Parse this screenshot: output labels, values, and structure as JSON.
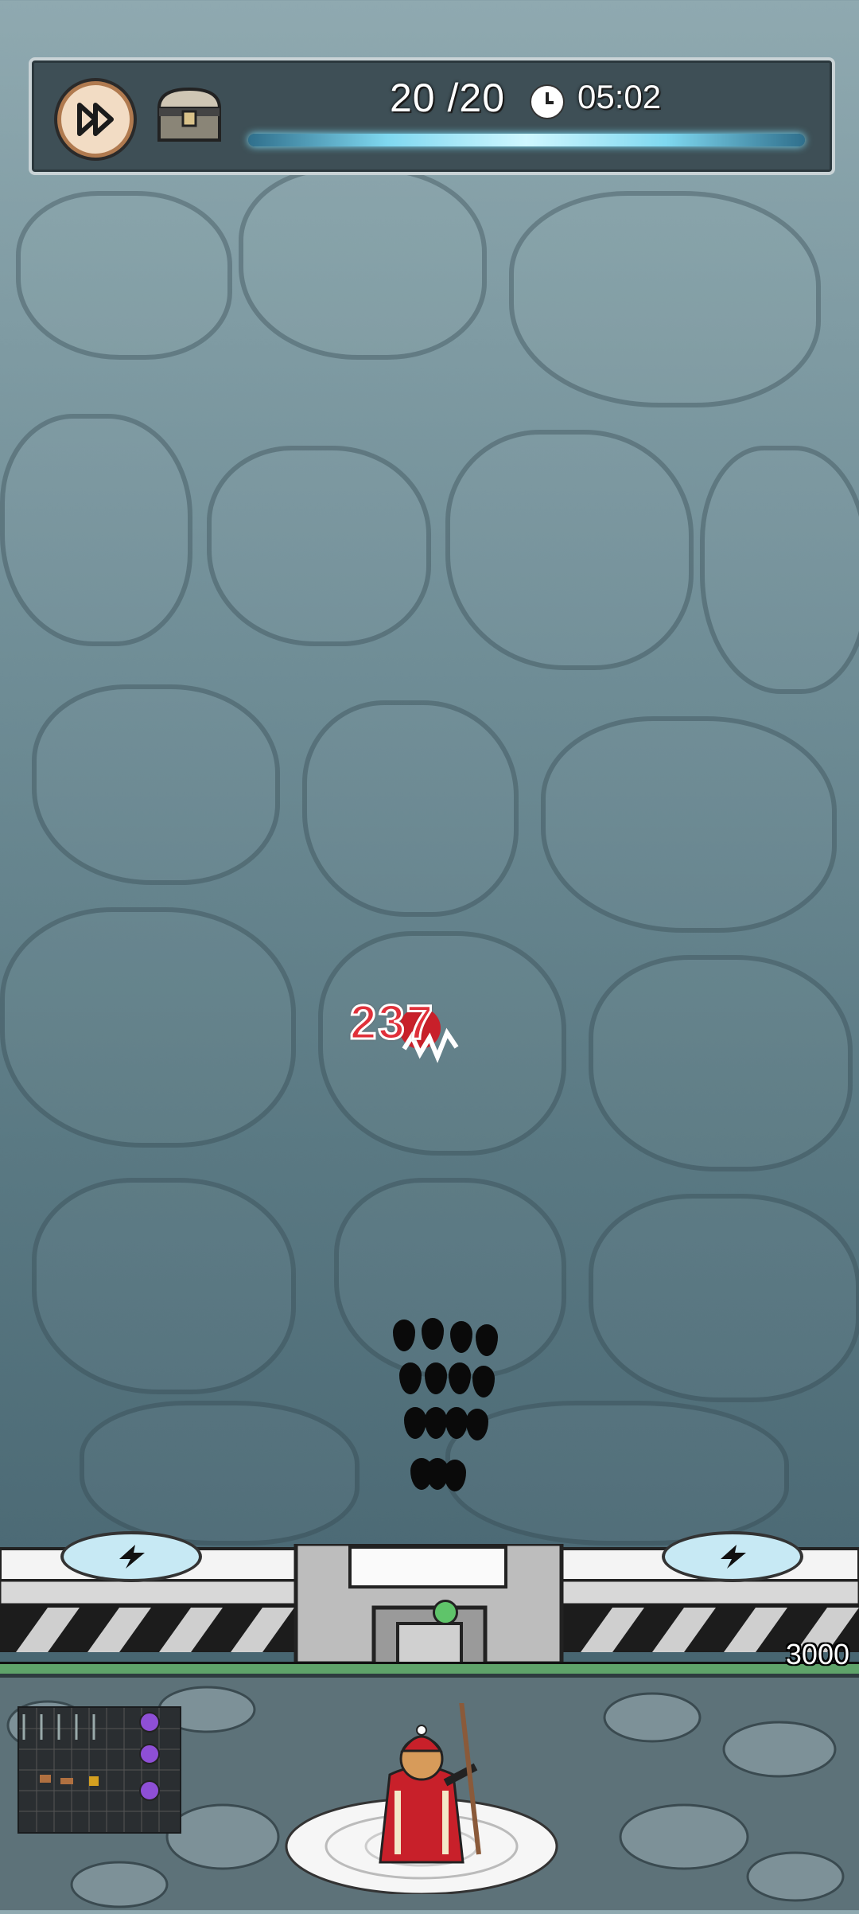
{
  "hud": {
    "wave": "20 /20",
    "timer": "05:02",
    "fast_forward_icon": "fast-forward-icon",
    "chest_icon": "treasure-chest-icon",
    "clock_icon": "clock-icon"
  },
  "battle": {
    "damage_number": "237"
  },
  "wall": {
    "hp_value": "3000",
    "hp_fraction": 1.0
  },
  "colors": {
    "hud_bg": "#3e4f56",
    "damage": "#e0303a",
    "hp_bar": "#5fa36a",
    "energy": "#7fd8f0"
  }
}
